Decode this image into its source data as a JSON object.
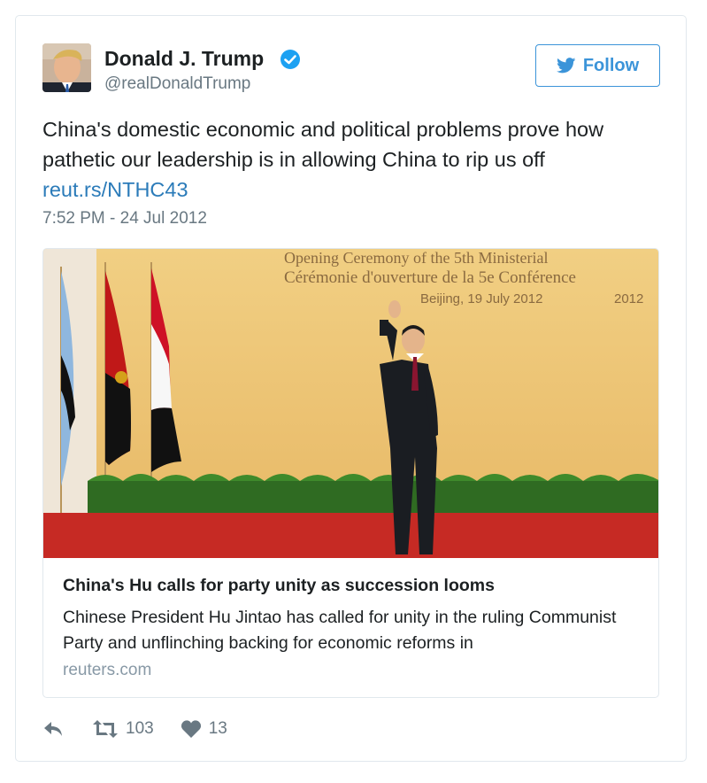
{
  "author": {
    "name": "Donald J. Trump",
    "handle": "@realDonaldTrump",
    "avatar_icon": "profile-photo",
    "verified_icon": "verified-badge-icon"
  },
  "follow_button": {
    "label": "Follow",
    "icon": "twitter-bird-icon",
    "color": "#3b94d9"
  },
  "tweet": {
    "text": "China's domestic economic and political problems prove how pathetic our leadership is in allowing China to rip us off",
    "link": "reut.rs/NTHC43",
    "timestamp": "7:52 PM - 24 Jul 2012"
  },
  "link_card": {
    "photo_caption_lines": [
      "Opening Ceremony of the 5th Ministerial",
      "Cérémonie d'ouverture de la 5e Conférence",
      "Beijing, 19 July 2012",
      "2012"
    ],
    "title": "China's Hu calls for party unity as succession looms",
    "description": "Chinese President Hu Jintao has called for unity in the ruling Communist Party and unflinching backing for economic reforms in",
    "domain": "reuters.com"
  },
  "actions": {
    "reply_icon": "reply-icon",
    "retweet_icon": "retweet-icon",
    "retweet_count": "103",
    "like_icon": "heart-icon",
    "like_count": "13"
  },
  "colors": {
    "link": "#2b7bb9",
    "muted": "#697882",
    "border": "#e1e8ed"
  }
}
